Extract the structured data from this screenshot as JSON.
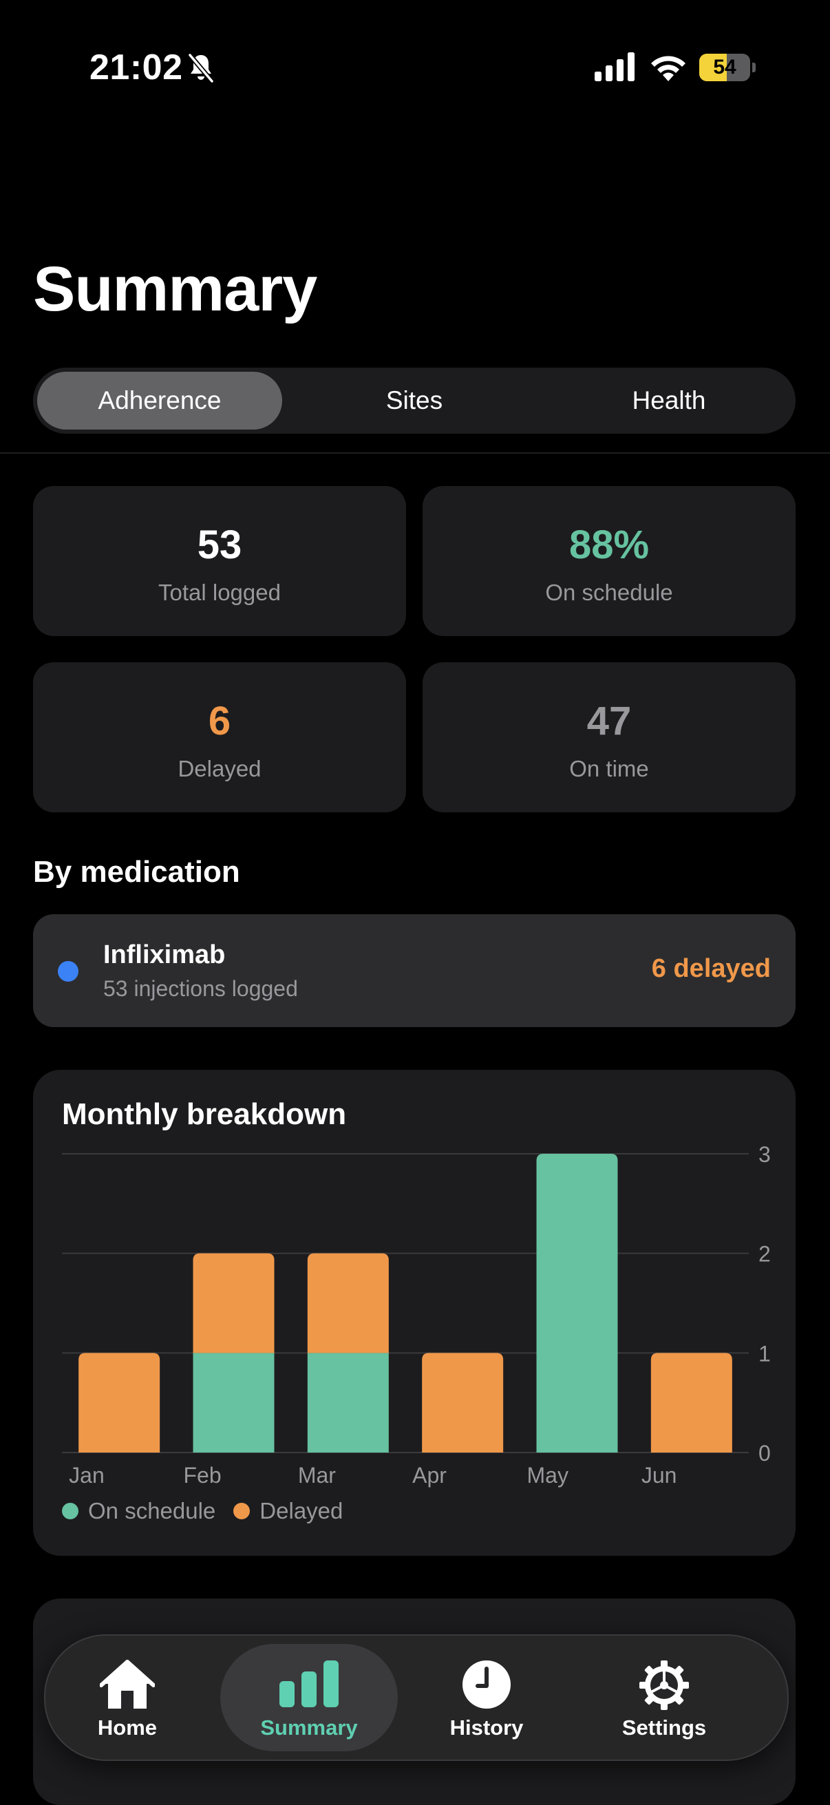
{
  "status_bar": {
    "time": "21:02",
    "battery": "54",
    "battery_level": 0.54
  },
  "page": {
    "title": "Summary"
  },
  "segments": [
    {
      "label": "Adherence",
      "selected": true
    },
    {
      "label": "Sites",
      "selected": false
    },
    {
      "label": "Health",
      "selected": false
    }
  ],
  "stats": [
    {
      "value": "53",
      "label": "Total logged",
      "color": "#ffffff"
    },
    {
      "value": "88%",
      "label": "On schedule",
      "color": "#66c2a0"
    },
    {
      "value": "6",
      "label": "Delayed",
      "color": "#f0984a"
    },
    {
      "value": "47",
      "label": "On time",
      "color": "#98989d"
    }
  ],
  "by_medication": {
    "title": "By medication",
    "items": [
      {
        "name": "Infliximab",
        "subtitle": "53 injections logged",
        "status": "6 delayed",
        "dot_color": "#3b82f6"
      }
    ]
  },
  "chart": {
    "title": "Monthly breakdown"
  },
  "chart_data": {
    "type": "bar",
    "stacked": true,
    "categories": [
      "Jan",
      "Feb",
      "Mar",
      "Apr",
      "May",
      "Jun"
    ],
    "series": [
      {
        "name": "On schedule",
        "color": "#66c2a0",
        "values": [
          0,
          1,
          1,
          0,
          3,
          0
        ]
      },
      {
        "name": "Delayed",
        "color": "#f0984a",
        "values": [
          1,
          1,
          1,
          1,
          0,
          1
        ]
      }
    ],
    "ylim": [
      0,
      3
    ],
    "yticks": [
      0,
      1,
      2,
      3
    ],
    "y_axis_side": "right",
    "grid": true,
    "legend_placement": "bottom-left"
  },
  "tabbar": [
    {
      "label": "Home",
      "icon": "house-icon",
      "active": false
    },
    {
      "label": "Summary",
      "icon": "chart-bar-icon",
      "active": true
    },
    {
      "label": "History",
      "icon": "clock-icon",
      "active": false
    },
    {
      "label": "Settings",
      "icon": "gear-icon",
      "active": false
    }
  ]
}
